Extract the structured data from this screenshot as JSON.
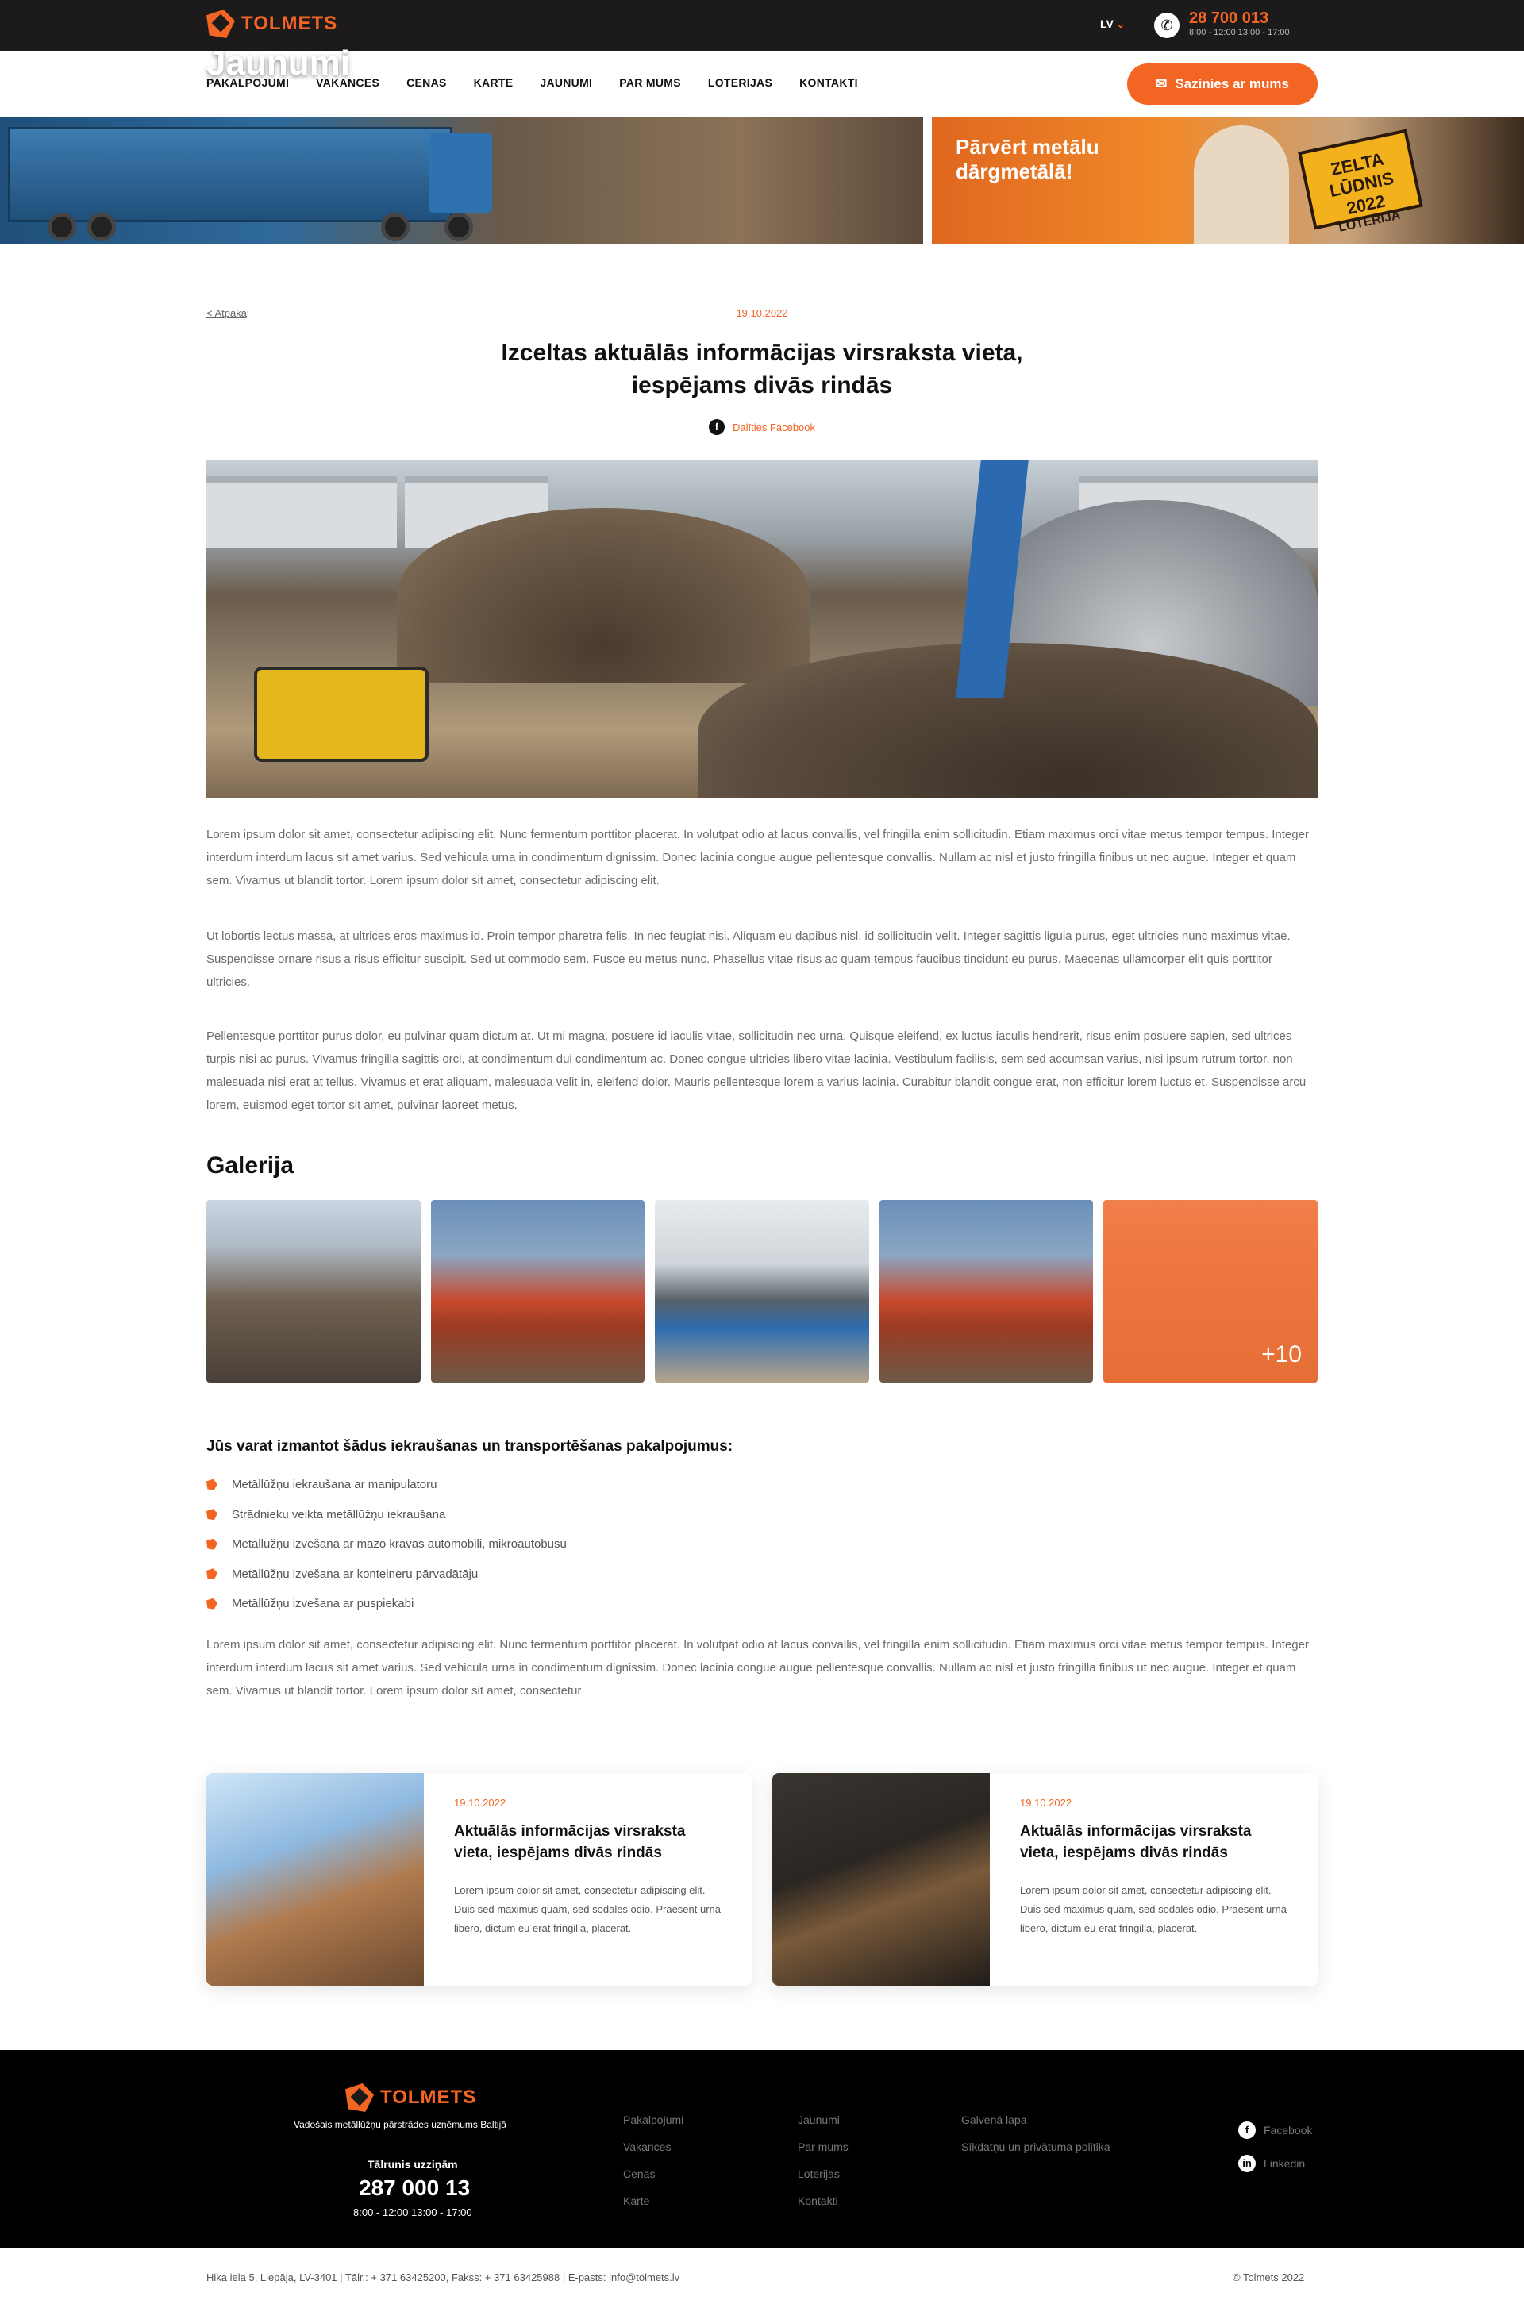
{
  "brand": {
    "name": "TOLMETS",
    "accent": "#f26522",
    "dark": "#1c1a1a"
  },
  "topbar": {
    "lang": "LV",
    "phone": "28 700 013",
    "hours": "8:00 - 12:00   13:00 - 17:00"
  },
  "nav": {
    "items": [
      "PAKALPOJUMI",
      "VAKANCES",
      "CENAS",
      "KARTE",
      "JAUNUMI",
      "PAR MUMS",
      "LOTERIJAS",
      "KONTAKTI"
    ],
    "contact_button": "Sazinies ar mums"
  },
  "hero": {
    "title": "Jaunumi"
  },
  "promo": {
    "text": "Pārvērt metālu dārgmetālā!",
    "badge_line1": "ZELTA LŪDNIS 2022",
    "badge_line2": "LOTERIJA"
  },
  "article": {
    "back": "< Atpakaļ",
    "date": "19.10.2022",
    "title": "Izceltas aktuālās informācijas virsraksta vieta, iespējams divās rindās",
    "share": "Dalīties Facebook",
    "paragraphs": [
      "Lorem ipsum dolor sit amet, consectetur adipiscing elit. Nunc fermentum porttitor placerat. In volutpat odio at lacus convallis, vel fringilla enim sollicitudin. Etiam maximus orci vitae metus tempor tempus. Integer interdum interdum lacus sit amet varius. Sed vehicula urna in condimentum dignissim. Donec lacinia congue augue pellentesque convallis. Nullam ac nisl et justo fringilla finibus ut nec augue. Integer et quam sem. Vivamus ut blandit tortor. Lorem ipsum dolor sit amet, consectetur adipiscing elit.",
      "Ut lobortis lectus massa, at ultrices eros maximus id. Proin tempor pharetra felis. In nec feugiat nisi. Aliquam eu dapibus nisl, id sollicitudin velit. Integer sagittis ligula purus, eget ultricies nunc maximus vitae. Suspendisse ornare risus a risus efficitur suscipit. Sed ut commodo sem. Fusce eu metus nunc. Phasellus vitae risus ac quam tempus faucibus tincidunt eu purus. Maecenas ullamcorper elit quis porttitor ultricies.",
      "Pellentesque porttitor purus dolor, eu pulvinar quam dictum at. Ut mi magna, posuere id iaculis vitae, sollicitudin nec urna. Quisque eleifend, ex luctus iaculis hendrerit, risus enim posuere sapien, sed ultrices turpis nisi ac purus. Vivamus fringilla sagittis orci, at condimentum dui condimentum ac. Donec congue ultricies libero vitae lacinia. Vestibulum facilisis, sem sed accumsan varius, nisi ipsum rutrum tortor, non malesuada nisi erat at tellus. Vivamus et erat aliquam, malesuada velit in, eleifend dolor. Mauris pellentesque lorem a varius lacinia. Curabitur blandit congue erat, non efficitur lorem luctus et. Suspendisse arcu lorem, euismod eget tortor sit amet, pulvinar laoreet metus."
    ],
    "gallery_title": "Galerija",
    "gallery_more": "+10",
    "services_title": "Jūs varat izmantot šādus iekraušanas un transportēšanas pakalpojumus:",
    "services": [
      "Metāllūžņu iekraušana ar manipulatoru",
      "Strādnieku veikta metāllūžņu iekraušana",
      "Metāllūžņu izvešana ar mazo kravas automobili, mikroautobusu",
      "Metāllūžņu izvešana ar konteineru pārvadātāju",
      "Metāllūžņu izvešana ar puspiekabi"
    ],
    "closing": "Lorem ipsum dolor sit amet, consectetur adipiscing elit. Nunc fermentum porttitor placerat. In volutpat odio at lacus convallis, vel fringilla enim sollicitudin. Etiam maximus orci vitae metus tempor tempus. Integer interdum interdum lacus sit amet varius. Sed vehicula urna in condimentum dignissim. Donec lacinia congue augue pellentesque convallis. Nullam ac nisl et justo fringilla finibus ut nec augue. Integer et quam sem. Vivamus ut blandit tortor. Lorem ipsum dolor sit amet, consectetur"
  },
  "related": [
    {
      "date": "19.10.2022",
      "title": "Aktuālās informācijas virsraksta vieta, iespējams divās rindās",
      "text": "Lorem ipsum dolor sit amet, consectetur adipiscing elit. Duis sed maximus quam, sed sodales odio. Praesent urna libero, dictum eu erat fringilla, placerat."
    },
    {
      "date": "19.10.2022",
      "title": "Aktuālās informācijas virsraksta vieta, iespējams divās rindās",
      "text": "Lorem ipsum dolor sit amet, consectetur adipiscing elit. Duis sed maximus quam, sed sodales odio. Praesent urna libero, dictum eu erat fringilla, placerat."
    }
  ],
  "footer": {
    "tagline": "Vadošais metāllūžņu pārstrādes uzņēmums Baltijā",
    "phone_label": "Tālrunis uzziņām",
    "phone": "287 000 13",
    "hours": "8:00 - 12:00 13:00 - 17:00",
    "col1": [
      "Pakalpojumi",
      "Vakances",
      "Cenas",
      "Karte"
    ],
    "col2": [
      "Jaunumi",
      "Par mums",
      "Loterijas",
      "Kontakti"
    ],
    "col3": [
      "Galvenā lapa",
      "Sīkdatņu un privātuma politika"
    ],
    "social": [
      "Facebook",
      "Linkedin"
    ],
    "address": "Hika iela 5, Liepāja, LV-3401 | Tālr.: + 371 63425200, Fakss: + 371 63425988 | E-pasts: info@tolmets.lv",
    "copyright": "© Tolmets 2022"
  }
}
